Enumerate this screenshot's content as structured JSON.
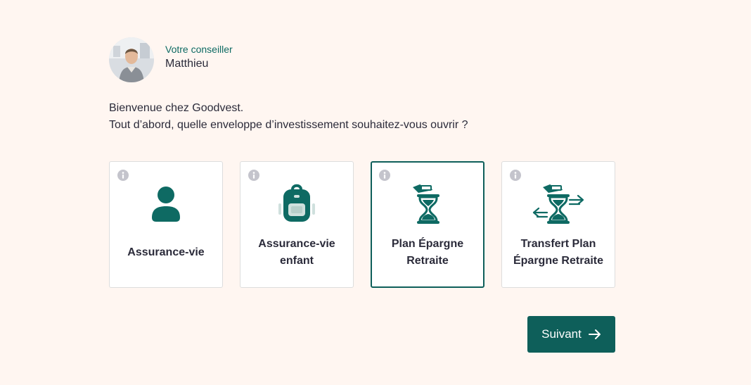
{
  "advisor": {
    "role": "Votre conseiller",
    "name": "Matthieu"
  },
  "intro": {
    "line1": "Bienvenue chez Goodvest.",
    "line2": "Tout d’abord, quelle enveloppe d’investissement souhaitez-vous ouvrir ?"
  },
  "cards": [
    {
      "line1": "Assurance-vie",
      "icon": "person-icon",
      "selected": false
    },
    {
      "line1": "Assurance-vie",
      "line2": "enfant",
      "icon": "backpack-icon",
      "selected": false
    },
    {
      "line1": "Plan Épargne",
      "line2": "Retraite",
      "icon": "hourglass-icon",
      "selected": true
    },
    {
      "line1": "Transfert Plan",
      "line2": "Épargne Retraite",
      "icon": "hourglass-transfer-icon",
      "selected": false
    }
  ],
  "next_button": {
    "label": "Suivant",
    "icon": "arrow-right-icon"
  },
  "colors": {
    "background": "#fff6f1",
    "accent": "#0e5f5a",
    "accent_text": "#0e6a63",
    "text": "#2b2b3a",
    "info_icon": "#c4c4cc"
  }
}
